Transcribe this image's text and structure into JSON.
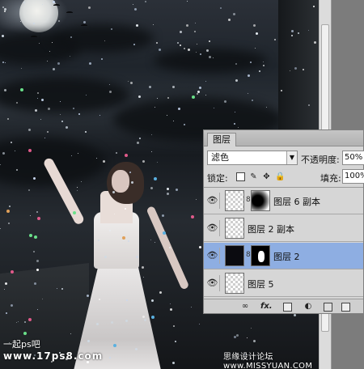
{
  "canvas": {
    "logo_line1": "一起ps吧",
    "logo_line2": "www.17ps8.com",
    "watermark": "思缘设计论坛 www.MISSYUAN.COM"
  },
  "layers_panel": {
    "tab_label": "图层",
    "blend_mode": "滤色",
    "opacity_label": "不透明度:",
    "opacity_value": "50%",
    "lock_label": "锁定:",
    "fill_label": "填充:",
    "fill_value": "100%",
    "layers": [
      {
        "name": "图层 6 副本",
        "selected": false,
        "has_mask": true
      },
      {
        "name": "图层 2 副本",
        "selected": false,
        "has_mask": false
      },
      {
        "name": "图层 2",
        "selected": true,
        "has_mask": true
      },
      {
        "name": "图层 5",
        "selected": false,
        "has_mask": false
      }
    ],
    "bottom_icons": [
      "link-icon",
      "fx-icon",
      "add-mask-icon",
      "adjustment-icon",
      "new-group-icon",
      "new-layer-icon"
    ],
    "selection_color": "#8eaee2"
  }
}
